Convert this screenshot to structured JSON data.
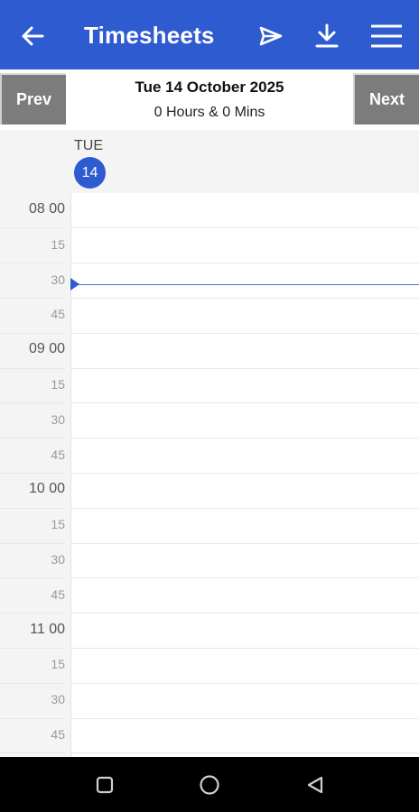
{
  "app_bar": {
    "title": "Timesheets",
    "background": "#2f5bd0",
    "icons": {
      "back": "arrow-left-icon",
      "send": "send-icon",
      "download": "download-icon",
      "menu": "menu-icon"
    }
  },
  "date_nav": {
    "prev_label": "Prev",
    "next_label": "Next",
    "date_title": "Tue 14 October 2025",
    "hours_summary": "0 Hours & 0 Mins"
  },
  "day_header": {
    "day_name": "TUE",
    "day_number": "14"
  },
  "time_grid": {
    "slots": [
      {
        "label": "08 00",
        "major": true
      },
      {
        "label": "15",
        "major": false
      },
      {
        "label": "30",
        "major": false
      },
      {
        "label": "45",
        "major": false
      },
      {
        "label": "09 00",
        "major": true
      },
      {
        "label": "15",
        "major": false
      },
      {
        "label": "30",
        "major": false
      },
      {
        "label": "45",
        "major": false
      },
      {
        "label": "10 00",
        "major": true
      },
      {
        "label": "15",
        "major": false
      },
      {
        "label": "30",
        "major": false
      },
      {
        "label": "45",
        "major": false
      },
      {
        "label": "11 00",
        "major": true
      },
      {
        "label": "15",
        "major": false
      },
      {
        "label": "30",
        "major": false
      },
      {
        "label": "45",
        "major": false
      }
    ],
    "current_time_slot_index": 2,
    "now_color": "#2f5bd0"
  },
  "system_nav": {
    "icons": [
      "recents-square-icon",
      "home-circle-icon",
      "back-triangle-icon"
    ]
  }
}
